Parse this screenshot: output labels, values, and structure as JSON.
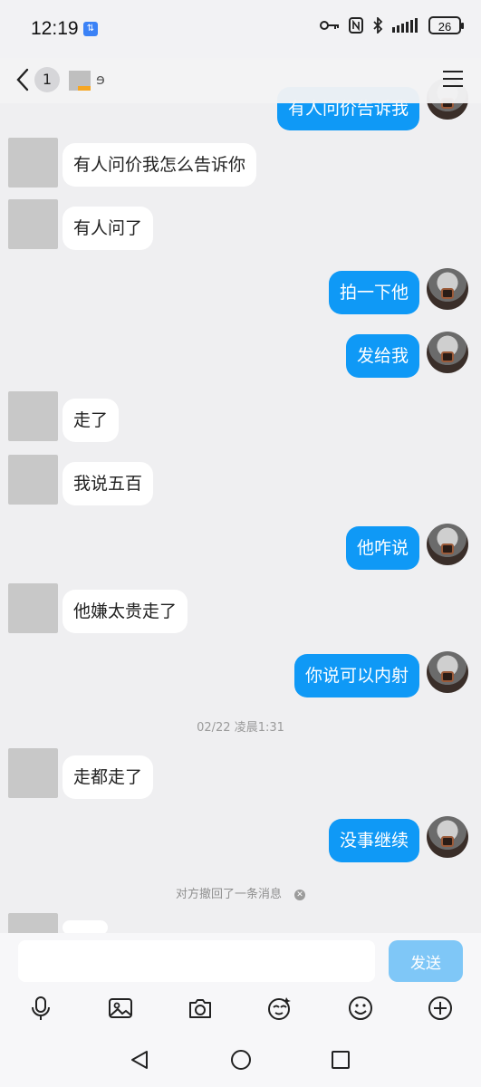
{
  "status_bar": {
    "time": "12:19",
    "battery": "26"
  },
  "header": {
    "unread_count": "1"
  },
  "messages": [
    {
      "side": "out",
      "text": "有人问价告诉我",
      "partial": true
    },
    {
      "side": "in",
      "text": "有人问价我怎么告诉你"
    },
    {
      "side": "in",
      "text": "有人问了"
    },
    {
      "side": "out",
      "text": "拍一下他"
    },
    {
      "side": "out",
      "text": "发给我"
    },
    {
      "side": "in",
      "text": "走了"
    },
    {
      "side": "in",
      "text": "我说五百"
    },
    {
      "side": "out",
      "text": "他咋说"
    },
    {
      "side": "in",
      "text": "他嫌太贵走了"
    },
    {
      "side": "out",
      "text": "你说可以内射"
    },
    {
      "side": "in",
      "text": "走都走了"
    },
    {
      "side": "out",
      "text": "没事继续"
    }
  ],
  "timestamp": "02/22 凌晨1:31",
  "recall_notice": "对方撤回了一条消息",
  "composer": {
    "input_value": "",
    "send_label": "发送"
  },
  "toolbar_icons": [
    "microphone-icon",
    "image-icon",
    "camera-icon",
    "sticker-icon",
    "emoji-icon",
    "plus-icon"
  ],
  "colors": {
    "bubble_out": "#0f99f6",
    "bubble_in": "#ffffff",
    "background": "#efeff1",
    "send_button": "#7fc7f7"
  }
}
